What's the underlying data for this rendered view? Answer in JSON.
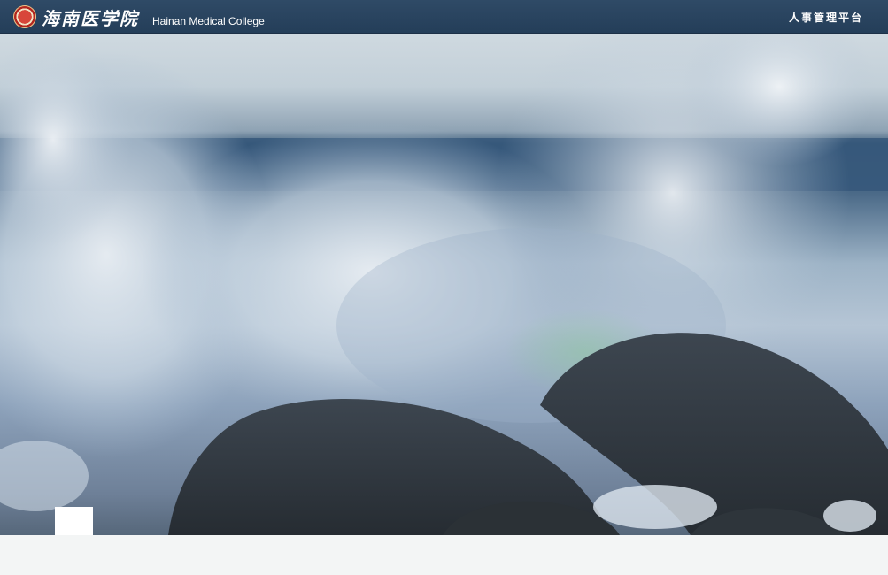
{
  "header": {
    "school_name_cn": "海南医学院",
    "school_name_en": "Hainan Medical College",
    "platform_title": "人事管理平台",
    "logo_icon": "school-emblem-icon"
  },
  "hero": {
    "image": "ocean-wave-crashing-on-rocks"
  },
  "colors": {
    "header_bg": "#2a4560",
    "page_bg": "#f3f5f5"
  }
}
